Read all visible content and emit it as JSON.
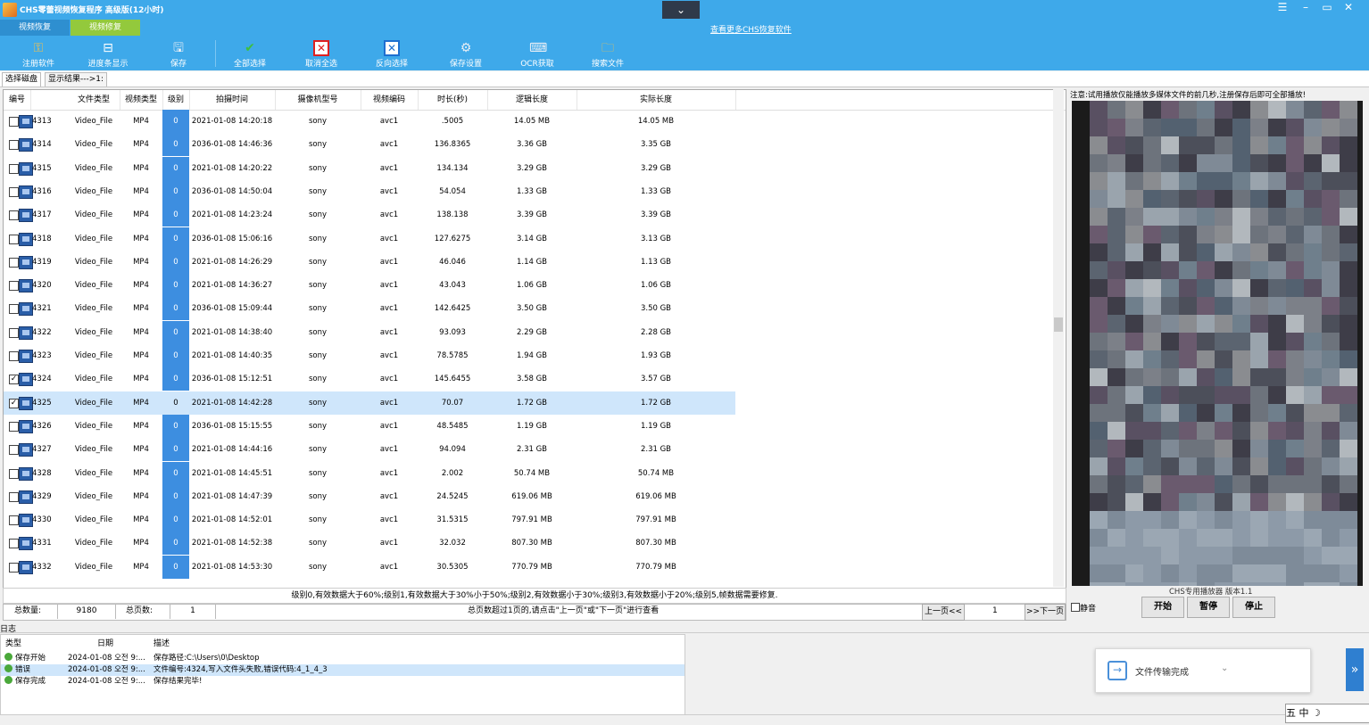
{
  "window": {
    "title": "CHS零蕾视频恢复程序 高级版(12小时)",
    "more_link": "查看更多CHS恢复软件",
    "controls": [
      "☰",
      "–",
      "▭",
      "✕"
    ]
  },
  "top_tabs": [
    "视频恢复",
    "视频修复"
  ],
  "toolbar": [
    {
      "label": "注册软件",
      "icon": "key-icon"
    },
    {
      "label": "进度条显示",
      "icon": "progress-icon"
    },
    {
      "label": "保存",
      "icon": "save-icon"
    },
    {
      "label": "全部选择",
      "icon": "check-icon"
    },
    {
      "label": "取消全选",
      "icon": "cancel-icon"
    },
    {
      "label": "反向选择",
      "icon": "invert-icon"
    },
    {
      "label": "保存设置",
      "icon": "settings-icon"
    },
    {
      "label": "OCR获取",
      "icon": "ocr-icon"
    },
    {
      "label": "搜索文件",
      "icon": "search-file-icon"
    }
  ],
  "sub_tabs": [
    "选择磁盘",
    "显示结果--->1:"
  ],
  "table": {
    "columns": [
      "编号",
      "文件类型",
      "视频类型",
      "级别",
      "拍摄时间",
      "摄像机型号",
      "视频编码",
      "时长(秒)",
      "逻辑长度",
      "实际长度"
    ],
    "rows": [
      {
        "id": "4313",
        "type": "Video_File",
        "vtype": "MP4",
        "level": "0",
        "time": "2021-01-08 14:20:18",
        "model": "sony",
        "codec": "avc1",
        "dur": ".5005",
        "logical": "14.05 MB",
        "actual": "14.05 MB",
        "checked": false
      },
      {
        "id": "4314",
        "type": "Video_File",
        "vtype": "MP4",
        "level": "0",
        "time": "2036-01-08 14:46:36",
        "model": "sony",
        "codec": "avc1",
        "dur": "136.8365",
        "logical": "3.36 GB",
        "actual": "3.35 GB",
        "checked": false
      },
      {
        "id": "4315",
        "type": "Video_File",
        "vtype": "MP4",
        "level": "0",
        "time": "2021-01-08 14:20:22",
        "model": "sony",
        "codec": "avc1",
        "dur": "134.134",
        "logical": "3.29 GB",
        "actual": "3.29 GB",
        "checked": false
      },
      {
        "id": "4316",
        "type": "Video_File",
        "vtype": "MP4",
        "level": "0",
        "time": "2036-01-08 14:50:04",
        "model": "sony",
        "codec": "avc1",
        "dur": "54.054",
        "logical": "1.33 GB",
        "actual": "1.33 GB",
        "checked": false
      },
      {
        "id": "4317",
        "type": "Video_File",
        "vtype": "MP4",
        "level": "0",
        "time": "2021-01-08 14:23:24",
        "model": "sony",
        "codec": "avc1",
        "dur": "138.138",
        "logical": "3.39 GB",
        "actual": "3.39 GB",
        "checked": false
      },
      {
        "id": "4318",
        "type": "Video_File",
        "vtype": "MP4",
        "level": "0",
        "time": "2036-01-08 15:06:16",
        "model": "sony",
        "codec": "avc1",
        "dur": "127.6275",
        "logical": "3.14 GB",
        "actual": "3.13 GB",
        "checked": false
      },
      {
        "id": "4319",
        "type": "Video_File",
        "vtype": "MP4",
        "level": "0",
        "time": "2021-01-08 14:26:29",
        "model": "sony",
        "codec": "avc1",
        "dur": "46.046",
        "logical": "1.14 GB",
        "actual": "1.13 GB",
        "checked": false
      },
      {
        "id": "4320",
        "type": "Video_File",
        "vtype": "MP4",
        "level": "0",
        "time": "2021-01-08 14:36:27",
        "model": "sony",
        "codec": "avc1",
        "dur": "43.043",
        "logical": "1.06 GB",
        "actual": "1.06 GB",
        "checked": false
      },
      {
        "id": "4321",
        "type": "Video_File",
        "vtype": "MP4",
        "level": "0",
        "time": "2036-01-08 15:09:44",
        "model": "sony",
        "codec": "avc1",
        "dur": "142.6425",
        "logical": "3.50 GB",
        "actual": "3.50 GB",
        "checked": false
      },
      {
        "id": "4322",
        "type": "Video_File",
        "vtype": "MP4",
        "level": "0",
        "time": "2021-01-08 14:38:40",
        "model": "sony",
        "codec": "avc1",
        "dur": "93.093",
        "logical": "2.29 GB",
        "actual": "2.28 GB",
        "checked": false
      },
      {
        "id": "4323",
        "type": "Video_File",
        "vtype": "MP4",
        "level": "0",
        "time": "2021-01-08 14:40:35",
        "model": "sony",
        "codec": "avc1",
        "dur": "78.5785",
        "logical": "1.94 GB",
        "actual": "1.93 GB",
        "checked": false
      },
      {
        "id": "4324",
        "type": "Video_File",
        "vtype": "MP4",
        "level": "0",
        "time": "2036-01-08 15:12:51",
        "model": "sony",
        "codec": "avc1",
        "dur": "145.6455",
        "logical": "3.58 GB",
        "actual": "3.57 GB",
        "checked": true
      },
      {
        "id": "4325",
        "type": "Video_File",
        "vtype": "MP4",
        "level": "0",
        "time": "2021-01-08 14:42:28",
        "model": "sony",
        "codec": "avc1",
        "dur": "70.07",
        "logical": "1.72 GB",
        "actual": "1.72 GB",
        "checked": true,
        "selected": true
      },
      {
        "id": "4326",
        "type": "Video_File",
        "vtype": "MP4",
        "level": "0",
        "time": "2036-01-08 15:15:55",
        "model": "sony",
        "codec": "avc1",
        "dur": "48.5485",
        "logical": "1.19 GB",
        "actual": "1.19 GB",
        "checked": false
      },
      {
        "id": "4327",
        "type": "Video_File",
        "vtype": "MP4",
        "level": "0",
        "time": "2021-01-08 14:44:16",
        "model": "sony",
        "codec": "avc1",
        "dur": "94.094",
        "logical": "2.31 GB",
        "actual": "2.31 GB",
        "checked": false
      },
      {
        "id": "4328",
        "type": "Video_File",
        "vtype": "MP4",
        "level": "0",
        "time": "2021-01-08 14:45:51",
        "model": "sony",
        "codec": "avc1",
        "dur": "2.002",
        "logical": "50.74 MB",
        "actual": "50.74 MB",
        "checked": false
      },
      {
        "id": "4329",
        "type": "Video_File",
        "vtype": "MP4",
        "level": "0",
        "time": "2021-01-08 14:47:39",
        "model": "sony",
        "codec": "avc1",
        "dur": "24.5245",
        "logical": "619.06 MB",
        "actual": "619.06 MB",
        "checked": false
      },
      {
        "id": "4330",
        "type": "Video_File",
        "vtype": "MP4",
        "level": "0",
        "time": "2021-01-08 14:52:01",
        "model": "sony",
        "codec": "avc1",
        "dur": "31.5315",
        "logical": "797.91 MB",
        "actual": "797.91 MB",
        "checked": false
      },
      {
        "id": "4331",
        "type": "Video_File",
        "vtype": "MP4",
        "level": "0",
        "time": "2021-01-08 14:52:38",
        "model": "sony",
        "codec": "avc1",
        "dur": "32.032",
        "logical": "807.30 MB",
        "actual": "807.30 MB",
        "checked": false
      },
      {
        "id": "4332",
        "type": "Video_File",
        "vtype": "MP4",
        "level": "0",
        "time": "2021-01-08 14:53:30",
        "model": "sony",
        "codec": "avc1",
        "dur": "30.5305",
        "logical": "770.79 MB",
        "actual": "770.79 MB",
        "checked": false
      }
    ]
  },
  "legend": "级别0,有效数据大于60%;级别1,有效数据大于30%小于50%;级别2,有效数据小于30%;级别3,有效数据小于20%;级别5,帧数据需要修复.",
  "pager": {
    "total_label": "总数量:",
    "total": "9180",
    "pages_label": "总页数:",
    "pages": "1",
    "hint": "总页数超过1页的,请点击\"上一页\"或\"下一页\"进行查看",
    "prev": "上一页<<",
    "current": "1",
    "next": ">>下一页"
  },
  "player": {
    "notice": "注意:试用播放仅能播放多媒体文件的前几秒,注册保存后即可全部播放!",
    "version": "CHS专用播放器 版本1.1",
    "mute": "静音",
    "buttons": [
      "开始",
      "暂停",
      "停止"
    ]
  },
  "log": {
    "title": "日志",
    "columns": [
      "类型",
      "日期",
      "描述"
    ],
    "rows": [
      {
        "type": "保存开始",
        "date": "2024-01-08 오전 9:...",
        "desc": "保存路径:C:\\Users\\0\\Desktop"
      },
      {
        "type": "错误",
        "date": "2024-01-08 오전 9:...",
        "desc": "文件编号:4324,写入文件头失败,错误代码:4_1_4_3"
      },
      {
        "type": "保存完成",
        "date": "2024-01-08 오전 9:...",
        "desc": "保存结果完毕!"
      }
    ]
  },
  "toast": {
    "text": "文件传输完成"
  },
  "ime": "五 中 ☽"
}
